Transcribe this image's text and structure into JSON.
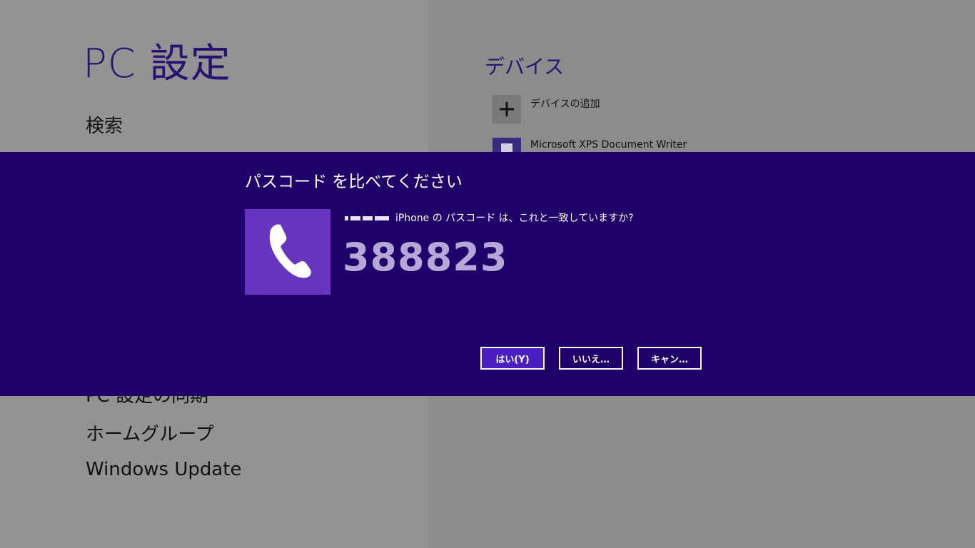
{
  "settings": {
    "title": "PC 設定",
    "nav": [
      "検索",
      "PC 設定の同期",
      "ホームグループ",
      "Windows Update"
    ]
  },
  "devices": {
    "section_title": "デバイス",
    "items": [
      {
        "label": "デバイスの追加",
        "icon": "plus-icon"
      },
      {
        "label": "Microsoft XPS Document Writer",
        "icon": "printer-icon"
      }
    ]
  },
  "dialog": {
    "title": "パスコード を比べてください",
    "question": "iPhone の パスコード は、これと一致していますか?",
    "passcode": "388823",
    "icon": "phone-icon",
    "buttons": {
      "yes": "はい(Y)",
      "no": "いいえ…",
      "cancel": "キャン…"
    }
  },
  "colors": {
    "dialog_bg": "#1f006a",
    "tile_bg": "#6636c0",
    "accent_text": "#2a1270",
    "passcode_text": "#b5a8d6",
    "primary_button": "#4a1fc0"
  }
}
